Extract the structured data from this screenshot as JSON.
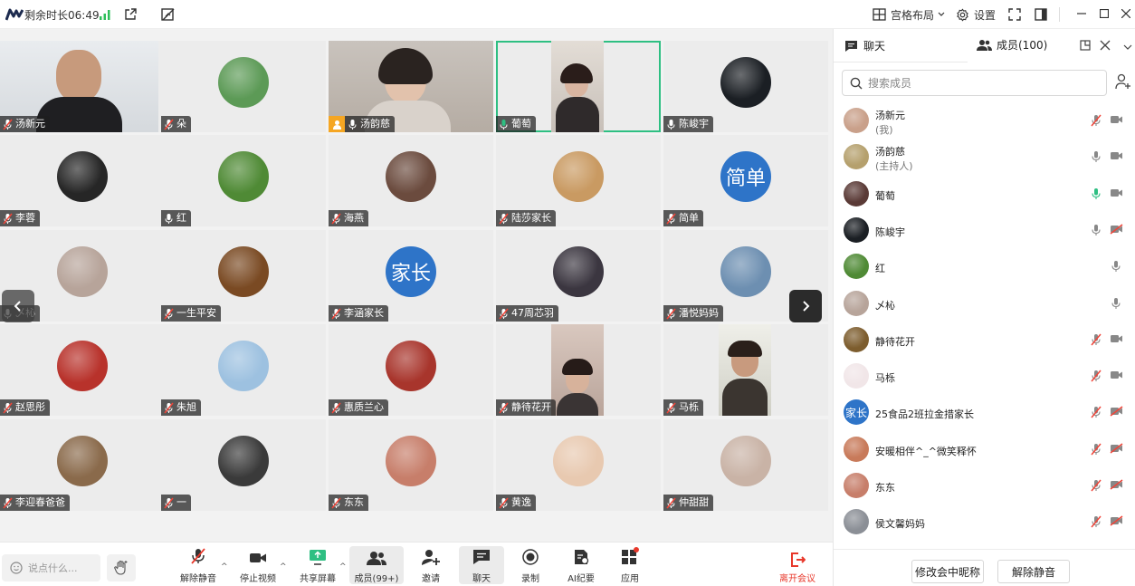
{
  "topbar": {
    "remaining_time": "剩余时长06:49",
    "grid_layout": "宫格布局",
    "settings": "设置"
  },
  "tiles": [
    {
      "name": "汤新元",
      "kind": "video",
      "bg": "#d8dde2"
    },
    {
      "name": "朵",
      "kind": "avatar",
      "bg": "#5c9a56"
    },
    {
      "name": "汤韵慈",
      "kind": "video",
      "bg": "#c8c2bc",
      "host": true,
      "mic": "on"
    },
    {
      "name": "葡萄",
      "kind": "video",
      "bg": "#d4cfc9",
      "active": true,
      "mic": "talk"
    },
    {
      "name": "陈峻宇",
      "kind": "avatar",
      "bg": "#1b1f24",
      "mic": "on"
    },
    {
      "name": "李蓉",
      "kind": "avatar",
      "bg": "#262626"
    },
    {
      "name": "红",
      "kind": "avatar",
      "bg": "#4f8a35",
      "mic": "on"
    },
    {
      "name": "海燕",
      "kind": "avatar",
      "bg": "#6b4b3e"
    },
    {
      "name": "陆莎家长",
      "kind": "avatar",
      "bg": "#c99a62"
    },
    {
      "name": "简单",
      "kind": "text",
      "text": "简单",
      "bg": "#2e74c8"
    },
    {
      "name": "乄杺",
      "kind": "avatar",
      "bg": "#b7a49a",
      "mic": "on"
    },
    {
      "name": "一生平安",
      "kind": "avatar",
      "bg": "#7a4a23"
    },
    {
      "name": "李涵家长",
      "kind": "text",
      "text": "家长",
      "bg": "#2e74c8"
    },
    {
      "name": "47周芯羽",
      "kind": "avatar",
      "bg": "#3b3640"
    },
    {
      "name": "潘悦妈妈",
      "kind": "avatar",
      "bg": "#6d8fb1"
    },
    {
      "name": "赵思彤",
      "kind": "avatar",
      "bg": "#b8322b"
    },
    {
      "name": "朱旭",
      "kind": "avatar",
      "bg": "#9dc1e0"
    },
    {
      "name": "惠质兰心",
      "kind": "avatar",
      "bg": "#a8352c"
    },
    {
      "name": "静待花开",
      "kind": "video",
      "bg": "#cdb8ad"
    },
    {
      "name": "马栎",
      "kind": "video",
      "bg": "#c9c9c2"
    },
    {
      "name": "李迎春爸爸",
      "kind": "avatar",
      "bg": "#8a6a4b"
    },
    {
      "name": "一",
      "kind": "avatar",
      "bg": "#3a3a3a"
    },
    {
      "name": "东东",
      "kind": "avatar",
      "bg": "#c77e6a"
    },
    {
      "name": "黄逸",
      "kind": "avatar",
      "bg": "#e8c9b0"
    },
    {
      "name": "仲甜甜",
      "kind": "avatar",
      "bg": "#c9b3a6"
    }
  ],
  "toolbar": {
    "chat_placeholder": "说点什么...",
    "items": [
      {
        "label": "解除静音",
        "icon": "mic-off-icon"
      },
      {
        "label": "停止视频",
        "icon": "camera-icon"
      },
      {
        "label": "共享屏幕",
        "icon": "share-screen-icon"
      },
      {
        "label": "成员(99+)",
        "icon": "members-icon"
      },
      {
        "label": "邀请",
        "icon": "invite-icon"
      },
      {
        "label": "聊天",
        "icon": "chat-icon"
      },
      {
        "label": "录制",
        "icon": "record-icon"
      },
      {
        "label": "AI纪要",
        "icon": "ai-notes-icon"
      },
      {
        "label": "应用",
        "icon": "apps-icon"
      }
    ],
    "leave_label": "离开会议",
    "leave_color": "#e8382b"
  },
  "panel": {
    "tab_chat": "聊天",
    "tab_members": "成员(100)",
    "search_placeholder": "搜索成员",
    "members": [
      {
        "name": "汤新元",
        "sub": "(我)",
        "bg": "#c9a08a",
        "mic": "off",
        "cam": "on"
      },
      {
        "name": "汤韵慈",
        "sub": "(主持人)",
        "bg": "#b5a06d",
        "mic": "on",
        "cam": "on"
      },
      {
        "name": "葡萄",
        "bg": "#5a3a36",
        "mic": "talk",
        "cam": "on"
      },
      {
        "name": "陈峻宇",
        "bg": "#1b1f24",
        "mic": "on",
        "cam": "off"
      },
      {
        "name": "红",
        "bg": "#4f8a35",
        "mic": "on",
        "cam": "none"
      },
      {
        "name": "乄杺",
        "bg": "#b7a49a",
        "mic": "on",
        "cam": "none"
      },
      {
        "name": "静待花开",
        "bg": "#7d5d2e",
        "mic": "off",
        "cam": "on"
      },
      {
        "name": "马栎",
        "bg": "#f1e6e8",
        "mic": "off",
        "cam": "on"
      },
      {
        "name": "25食品2班拉金措家长",
        "text": "家长",
        "bg": "#2e74c8",
        "mic": "off",
        "cam": "off"
      },
      {
        "name": "安暖相伴^_^微笑释怀",
        "bg": "#c87a5a",
        "mic": "off",
        "cam": "off"
      },
      {
        "name": "东东",
        "bg": "#c77e6a",
        "mic": "off",
        "cam": "off"
      },
      {
        "name": "侯文馨妈妈",
        "bg": "#8b8f96",
        "mic": "off",
        "cam": "off"
      }
    ],
    "rename_button": "修改会中昵称",
    "unmute_all_button": "解除静音"
  }
}
